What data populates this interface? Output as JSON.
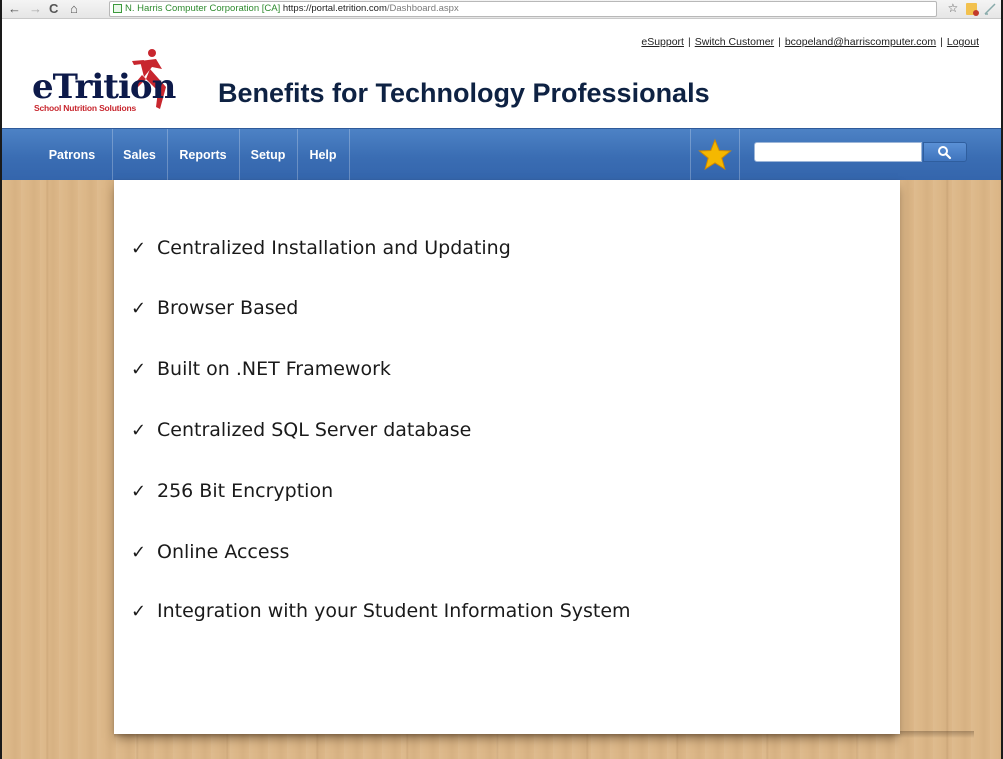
{
  "browser": {
    "back": "←",
    "forward": "→",
    "reload": "C",
    "home": "⌂",
    "ev_label": "N. Harris Computer Corporation [CA]",
    "url_scheme_host": "https://portal.etrition.com",
    "url_path": "/Dashboard.aspx",
    "bookmark_star": "☆"
  },
  "header": {
    "links": [
      "eSupport",
      "Switch Customer",
      "bcopeland@harriscomputer.com",
      "Logout"
    ],
    "separator": "|",
    "logo_text": "eTrition",
    "logo_tagline": "School Nutrition Solutions",
    "title": "Benefits for Technology Professionals"
  },
  "menu": {
    "items": [
      "Patrons",
      "Sales",
      "Reports",
      "Setup",
      "Help"
    ],
    "search_placeholder": ""
  },
  "benefits": {
    "check": "✓",
    "items": [
      "Centralized Installation and Updating",
      "Browser Based",
      "Built on .NET Framework",
      "Centralized SQL Server database",
      "256 Bit Encryption",
      "Online Access",
      "Integration with your Student Information System"
    ]
  },
  "colors": {
    "menu_blue": "#3a6db3",
    "title_navy": "#0e2243",
    "logo_red": "#c8262e",
    "wood": "#dcb788",
    "star": "#f5b800"
  }
}
